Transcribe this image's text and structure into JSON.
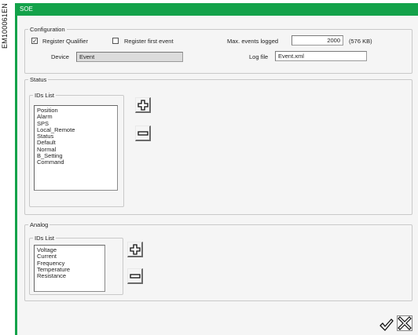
{
  "side_reference": "EM100061EN",
  "window": {
    "title": "SOE"
  },
  "configuration": {
    "legend": "Configuration",
    "register_qualifier": {
      "label": "Register Qualifier",
      "checked": true
    },
    "register_first_event": {
      "label": "Register first event",
      "checked": false
    },
    "max_events": {
      "label": "Max. events logged",
      "value": "2000",
      "size_note": "(576 KB)"
    },
    "device": {
      "label": "Device",
      "value": "Event"
    },
    "log_file": {
      "label": "Log file",
      "value": "Event.xml"
    }
  },
  "status": {
    "legend": "Status",
    "ids_list": {
      "legend": "IDs List",
      "items": [
        "Position",
        "Alarm",
        "SPS",
        "Local_Remote",
        "Status",
        "Default",
        "Normal",
        "B_Setting",
        "Command"
      ]
    },
    "add_icon": "plus-outline-icon",
    "remove_icon": "minus-outline-icon"
  },
  "analog": {
    "legend": "Analog",
    "ids_list": {
      "legend": "IDs List",
      "items": [
        "Voltage",
        "Current",
        "Frequency",
        "Temperature",
        "Resistance"
      ]
    },
    "add_icon": "plus-outline-icon",
    "remove_icon": "minus-outline-icon"
  },
  "footer": {
    "ok_icon": "checkmark-icon",
    "cancel_icon": "cross-icon"
  },
  "colors": {
    "titlebar": "#13a24a",
    "panel_bg": "#f5f5f5",
    "readonly_field": "#dcdcdc"
  }
}
